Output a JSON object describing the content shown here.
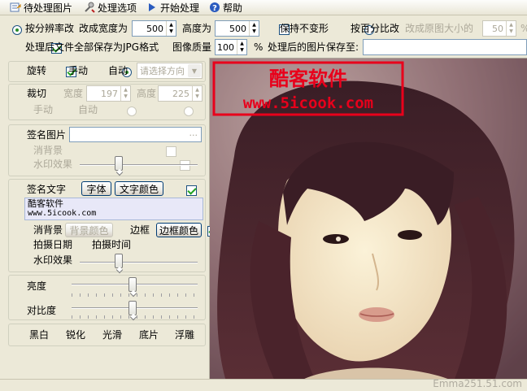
{
  "toolbar": {
    "items": [
      {
        "label": "待处理图片",
        "icon": "folder-icon"
      },
      {
        "label": "处理选项",
        "icon": "tools-icon"
      },
      {
        "label": "开始处理",
        "icon": "play-icon"
      },
      {
        "label": "帮助",
        "icon": "help-icon"
      }
    ]
  },
  "options": {
    "by_resolution_label": "按分辨率改",
    "change_width_label": "改成宽度为",
    "width_value": "500",
    "height_label": "高度为",
    "height_value": "500",
    "keep_ratio_label": "保持不变形",
    "by_percent_label": "按百分比改",
    "percent_label": "改成原图大小的",
    "percent_value": "50",
    "percent_unit": "%",
    "save_jpg_label": "处理后文件全部保存为JPG格式",
    "quality_label": "图像质量",
    "quality_value": "100",
    "quality_unit": "%",
    "save_to_label": "处理后的图片保存至:",
    "save_to_value": ""
  },
  "rotate": {
    "label": "旋转",
    "manual_label": "手动",
    "auto_label": "自动",
    "direction_placeholder": "请选择方向"
  },
  "crop": {
    "label": "裁切",
    "width_label": "宽度",
    "width_value": "197",
    "height_label": "高度",
    "height_value": "225",
    "manual_label": "手动",
    "auto_label": "自动"
  },
  "sign_image": {
    "label": "签名图片",
    "browse_label": "...",
    "remove_bg_label": "消背景",
    "watermark_label": "水印效果"
  },
  "sign_text": {
    "label": "签名文字",
    "font_button": "字体",
    "color_button": "文字颜色",
    "text_line1": "酷客软件",
    "text_line2": "www.5icook.com",
    "remove_bg_label": "消背景",
    "bg_color_button": "背景颜色",
    "border_label": "边框",
    "border_color_button": "边框颜色",
    "shoot_date_label": "拍摄日期",
    "shoot_time_label": "拍摄时间",
    "watermark_label": "水印效果"
  },
  "adjust": {
    "brightness_label": "亮度",
    "brightness_level": 0.5,
    "contrast_label": "对比度",
    "contrast_level": 0.5
  },
  "effects": {
    "items": [
      "黑白",
      "锐化",
      "光滑",
      "底片",
      "浮雕"
    ]
  },
  "preview": {
    "overlay_line1": "酷客软件",
    "overlay_line2": "www.5icook.com",
    "overlay_color": "#e8001b"
  },
  "watermark": "Emma251.51.com"
}
